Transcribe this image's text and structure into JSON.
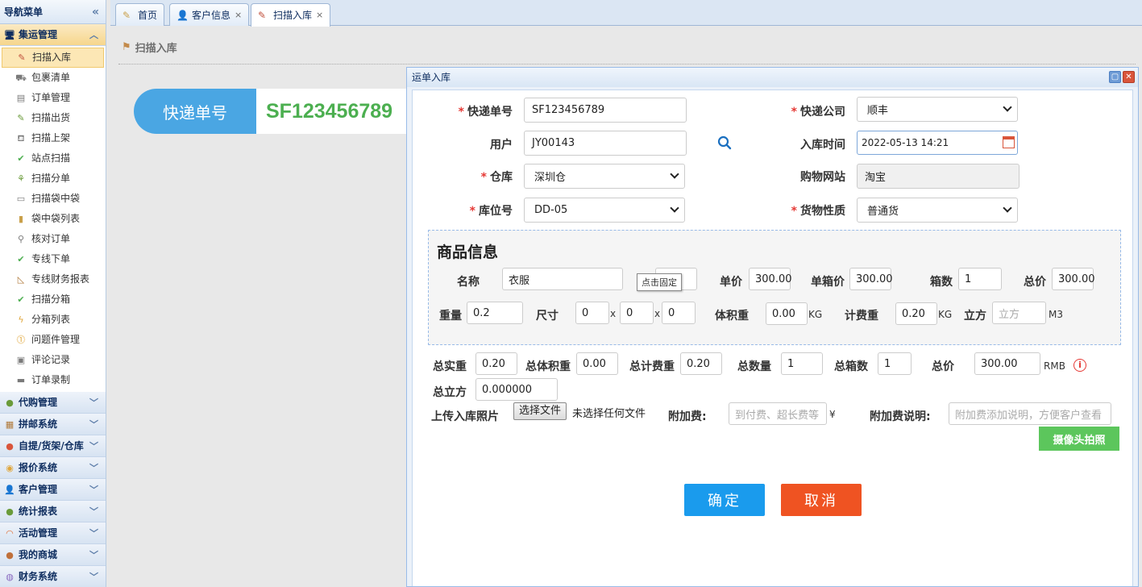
{
  "sidebar": {
    "title": "导航菜单",
    "groups_top": [
      {
        "label": "集运管理",
        "icon": "monitor-icon"
      }
    ],
    "items": [
      {
        "label": "扫描入库",
        "icon": "scan-gun-icon"
      },
      {
        "label": "包裹清单",
        "icon": "truck-icon"
      },
      {
        "label": "订单管理",
        "icon": "list-icon"
      },
      {
        "label": "扫描出货",
        "icon": "scan-gun-icon"
      },
      {
        "label": "扫描上架",
        "icon": "cart-icon"
      },
      {
        "label": "站点扫描",
        "icon": "check-icon"
      },
      {
        "label": "扫描分单",
        "icon": "split-icon"
      },
      {
        "label": "扫描袋中袋",
        "icon": "tray-icon"
      },
      {
        "label": "袋中袋列表",
        "icon": "book-icon"
      },
      {
        "label": "核对订单",
        "icon": "magnifier-icon"
      },
      {
        "label": "专线下单",
        "icon": "check-icon"
      },
      {
        "label": "专线财务报表",
        "icon": "ruler-icon"
      },
      {
        "label": "扫描分箱",
        "icon": "check-icon"
      },
      {
        "label": "分箱列表",
        "icon": "bolt-icon"
      },
      {
        "label": "问题件管理",
        "icon": "warning-icon"
      },
      {
        "label": "评论记录",
        "icon": "clipboard-icon"
      },
      {
        "label": "订单录制",
        "icon": "monitor-icon"
      }
    ],
    "groups": [
      {
        "label": "代购管理",
        "icon": "globe-icon"
      },
      {
        "label": "拼邮系统",
        "icon": "grid-icon"
      },
      {
        "label": "自提/货架/仓库",
        "icon": "ball-icon"
      },
      {
        "label": "报价系统",
        "icon": "coins-icon"
      },
      {
        "label": "客户管理",
        "icon": "user-icon"
      },
      {
        "label": "统计报表",
        "icon": "globe-icon"
      },
      {
        "label": "活动管理",
        "icon": "rainbow-icon"
      },
      {
        "label": "我的商城",
        "icon": "ball-icon"
      },
      {
        "label": "财务系统",
        "icon": "disc-icon"
      }
    ]
  },
  "tabs": [
    {
      "label": "首页",
      "icon": "pen-icon",
      "closable": false
    },
    {
      "label": "客户信息",
      "icon": "user-icon",
      "closable": true
    },
    {
      "label": "扫描入库",
      "icon": "scan-gun-icon",
      "closable": true
    }
  ],
  "page": {
    "heading": "扫描入库",
    "tracking_label": "快递单号",
    "tracking_value": "SF123456789"
  },
  "dialog": {
    "title": "运单入库",
    "form": {
      "tracking_no_label": "快递单号",
      "tracking_no": "SF123456789",
      "courier_label": "快递公司",
      "courier": "顺丰",
      "user_label": "用户",
      "user": "JY00143",
      "inbound_time_label": "入库时间",
      "inbound_time": "2022-05-13 14:21",
      "warehouse_label": "仓库",
      "warehouse": "深圳仓",
      "site_label": "购物网站",
      "site": "淘宝",
      "location_label": "库位号",
      "location": "DD-05",
      "cargo_type_label": "货物性质",
      "cargo_type": "普通货"
    },
    "goods": {
      "title": "商品信息",
      "name_label": "名称",
      "name": "衣服",
      "qty": "",
      "tooltip": "点击固定",
      "unit_price_label": "单价",
      "unit_price": "300.00",
      "box_price_label": "单箱价",
      "box_price": "300.00",
      "boxes_label": "箱数",
      "boxes": "1",
      "total_label": "总价",
      "total": "300.00",
      "weight_label": "重量",
      "weight": "0.2",
      "size_label": "尺寸",
      "size_l": "0",
      "size_w": "0",
      "size_h": "0",
      "size_sep": "x",
      "vol_weight_label": "体积重",
      "vol_weight": "0.00",
      "kg": "KG",
      "bill_weight_label": "计费重",
      "bill_weight": "0.20",
      "cube_label": "立方",
      "cube_placeholder": "立方",
      "m3": "M3"
    },
    "summary": {
      "total_actual_label": "总实重",
      "total_actual": "0.20",
      "total_vol_label": "总体积重",
      "total_vol": "0.00",
      "total_bill_label": "总计费重",
      "total_bill": "0.20",
      "total_qty_label": "总数量",
      "total_qty": "1",
      "total_boxes_label": "总箱数",
      "total_boxes": "1",
      "total_price_label": "总价",
      "total_price": "300.00",
      "currency": "RMB",
      "total_cube_label": "总立方",
      "total_cube": "0.000000"
    },
    "upload": {
      "label": "上传入库照片",
      "button": "选择文件",
      "status": "未选择任何文件",
      "fee_label": "附加费:",
      "fee_placeholder": "到付费、超长费等",
      "yen": "¥",
      "fee_note_label": "附加费说明:",
      "fee_note_placeholder": "附加费添加说明，方便客户查看",
      "camera_button": "摄像头拍照"
    },
    "confirm": "确定",
    "cancel": "取消"
  }
}
